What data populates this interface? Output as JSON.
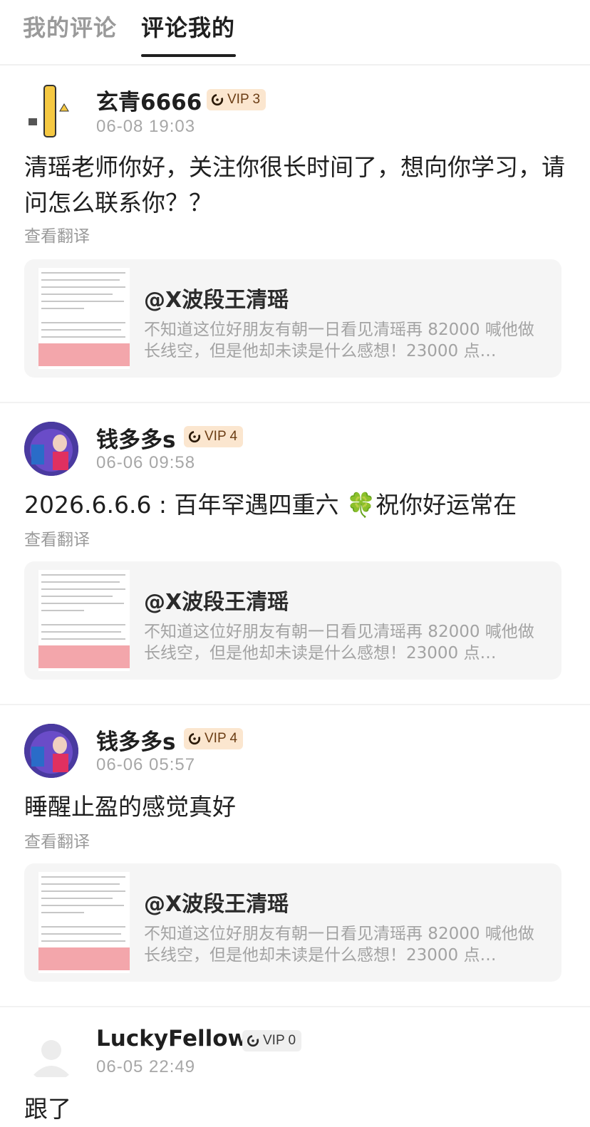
{
  "tabs": [
    {
      "label": "我的评论",
      "active": false
    },
    {
      "label": "评论我的",
      "active": true
    }
  ],
  "quote": {
    "title": "@X波段王清瑶",
    "body": "不知道这位好朋友有朝一日看见清瑶再 82000 喊他做长线空，但是他却未读是什么感想！23000 点…"
  },
  "comments": [
    {
      "username": "玄青6666",
      "vip": "VIP 3",
      "time": "06-08 19:03",
      "text": "清瑶老师你好，关注你很长时间了，想向你学习，请问怎么联系你？？",
      "translate": "查看翻译"
    },
    {
      "username": "钱多多s",
      "vip": "VIP 4",
      "time": "06-06 09:58",
      "text": "2026.6.6.6 : 百年罕遇四重六 🍀祝你好运常在",
      "translate": "查看翻译"
    },
    {
      "username": "钱多多s",
      "vip": "VIP 4",
      "time": "06-06 05:57",
      "text": "睡醒止盈的感觉真好",
      "translate": "查看翻译"
    },
    {
      "username": "LuckyFellow",
      "vip": "VIP 0",
      "time": "06-05 22:49",
      "text": "跟了",
      "translate": ""
    }
  ],
  "colors": {
    "vip_bg": "#fbe6cf",
    "vip_text": "#6b3d14",
    "vip0_bg": "#efefef",
    "muted": "#a7a7a7",
    "card_bg": "#f5f5f5",
    "thumb_highlight": "#f3a6ab"
  },
  "icons": {
    "vip": "vip-badge-icon",
    "avatar_default": "default-avatar-icon"
  }
}
